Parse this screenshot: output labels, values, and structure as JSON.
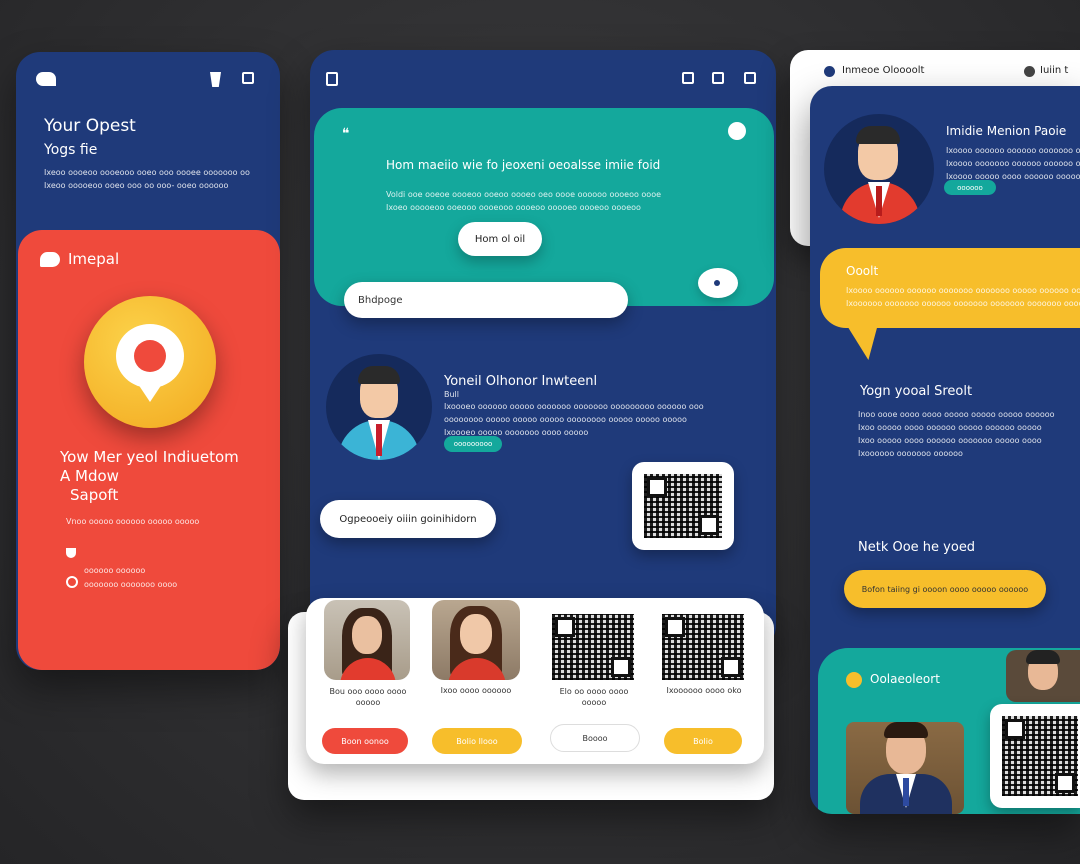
{
  "left_card": {
    "title_line1": "Your Opest",
    "title_line2": "Yogs fie",
    "desc_line1": "Ixeoo oooeoo oooeooo ooeo ooo oooee ooooooo oo",
    "desc_line2": "Ixeoo ooooeoo ooeo ooo oo ooo- ooeo oooooo",
    "red_section_title": "Imepal",
    "headline_line1": "Yow Mer yeol Indiuetom",
    "headline_line2": "A Mdow",
    "headline_line3": "Sapoft",
    "red_desc": "Vnoo ooooo oooooo ooooo ooooo",
    "list_item1": "oooooo oooooo",
    "list_item2": "ooooooo ooooooo oooo"
  },
  "middle_card": {
    "teal_heading": "Hom maeiio wie fo jeoxeni oeoalsse imiie foid",
    "teal_desc_line1": "Voldi ooe ooeoe oooeoo ooeoo oooeo oeo oooe oooooo oooeoo oooe",
    "teal_desc_line2": "Ixoeo ooooeoo ooeooo oooeooo oooeoo ooooeo oooeoo oooeoo",
    "teal_button": "Hom ol oil",
    "search_placeholder": "Bhdpoge",
    "profile_name": "Yoneil Olhonor Inwteenl",
    "profile_sub": "Bull",
    "profile_desc_line1": "Ixoooeo oooooo ooooo ooooooo ooooooo ooooooooo oooooo ooo",
    "profile_desc_line2": "oooooooo ooooo ooooo ooooo oooooooo ooooo ooooo ooooo",
    "profile_desc_line3": "Ixoooeo ooooo ooooooo oooo ooooo",
    "profile_tag": "ooooooooo",
    "pill_label": "Ogpeooeiy oiiin goinihidorn"
  },
  "bottom_panel": {
    "caption1": "Bou ooo oooo oooo",
    "caption1b": "ooooo",
    "caption2": "Ixoo oooo oooooo",
    "caption3": "Elo oo oooo oooo",
    "caption3b": "ooooo",
    "caption4": "Ixoooooo oooo oko",
    "button1": "Boon oonoo",
    "button2": "Bolio llooo",
    "button3": "Boooo",
    "button4": "Bolio"
  },
  "right_card": {
    "top_label": "Inmeoe Oloooolt",
    "top_label_right": "Iuiin t",
    "profile_name": "Imidie Menion Paoie",
    "profile_desc_line1": "Ixoooo oooooo oooooo ooooooo ooooo",
    "profile_desc_line2": "Ixoooo ooooooo oooooo oooooo ooooo",
    "profile_desc_line3": "Ixoooo ooooo oooo oooooo ooooo",
    "profile_tag": "oooooo",
    "yellow_title": "Ooolt",
    "yellow_desc_line1": "Ixoooo oooooo oooooo ooooooo ooooooo ooooo oooooo oooooo",
    "yellow_desc_line2": "Ixoooooo ooooooo oooooo ooooooo ooooooo ooooooo oooooo",
    "section_title": "Yogn yooal Sreolt",
    "section_desc_line1": "Inoo oooe oooo oooo ooooo ooooo ooooo oooooo",
    "section_desc_line2": "Ixoo ooooo oooo oooooo ooooo oooooo ooooo",
    "section_desc_line3": "Ixoo ooooo oooo oooooo ooooooo ooooo oooo",
    "section_desc_line4": "Ixoooooo ooooooo oooooo",
    "cta_title": "Netk Ooe he yoed",
    "cta_button": "Bofon taiing gi oooon oooo ooooo oooooo",
    "teal_label": "Oolaeoleort"
  },
  "colors": {
    "navy": "#1f3a7a",
    "teal": "#14a89c",
    "red": "#ef4a3c",
    "yellow": "#f7be2b",
    "white": "#ffffff"
  }
}
